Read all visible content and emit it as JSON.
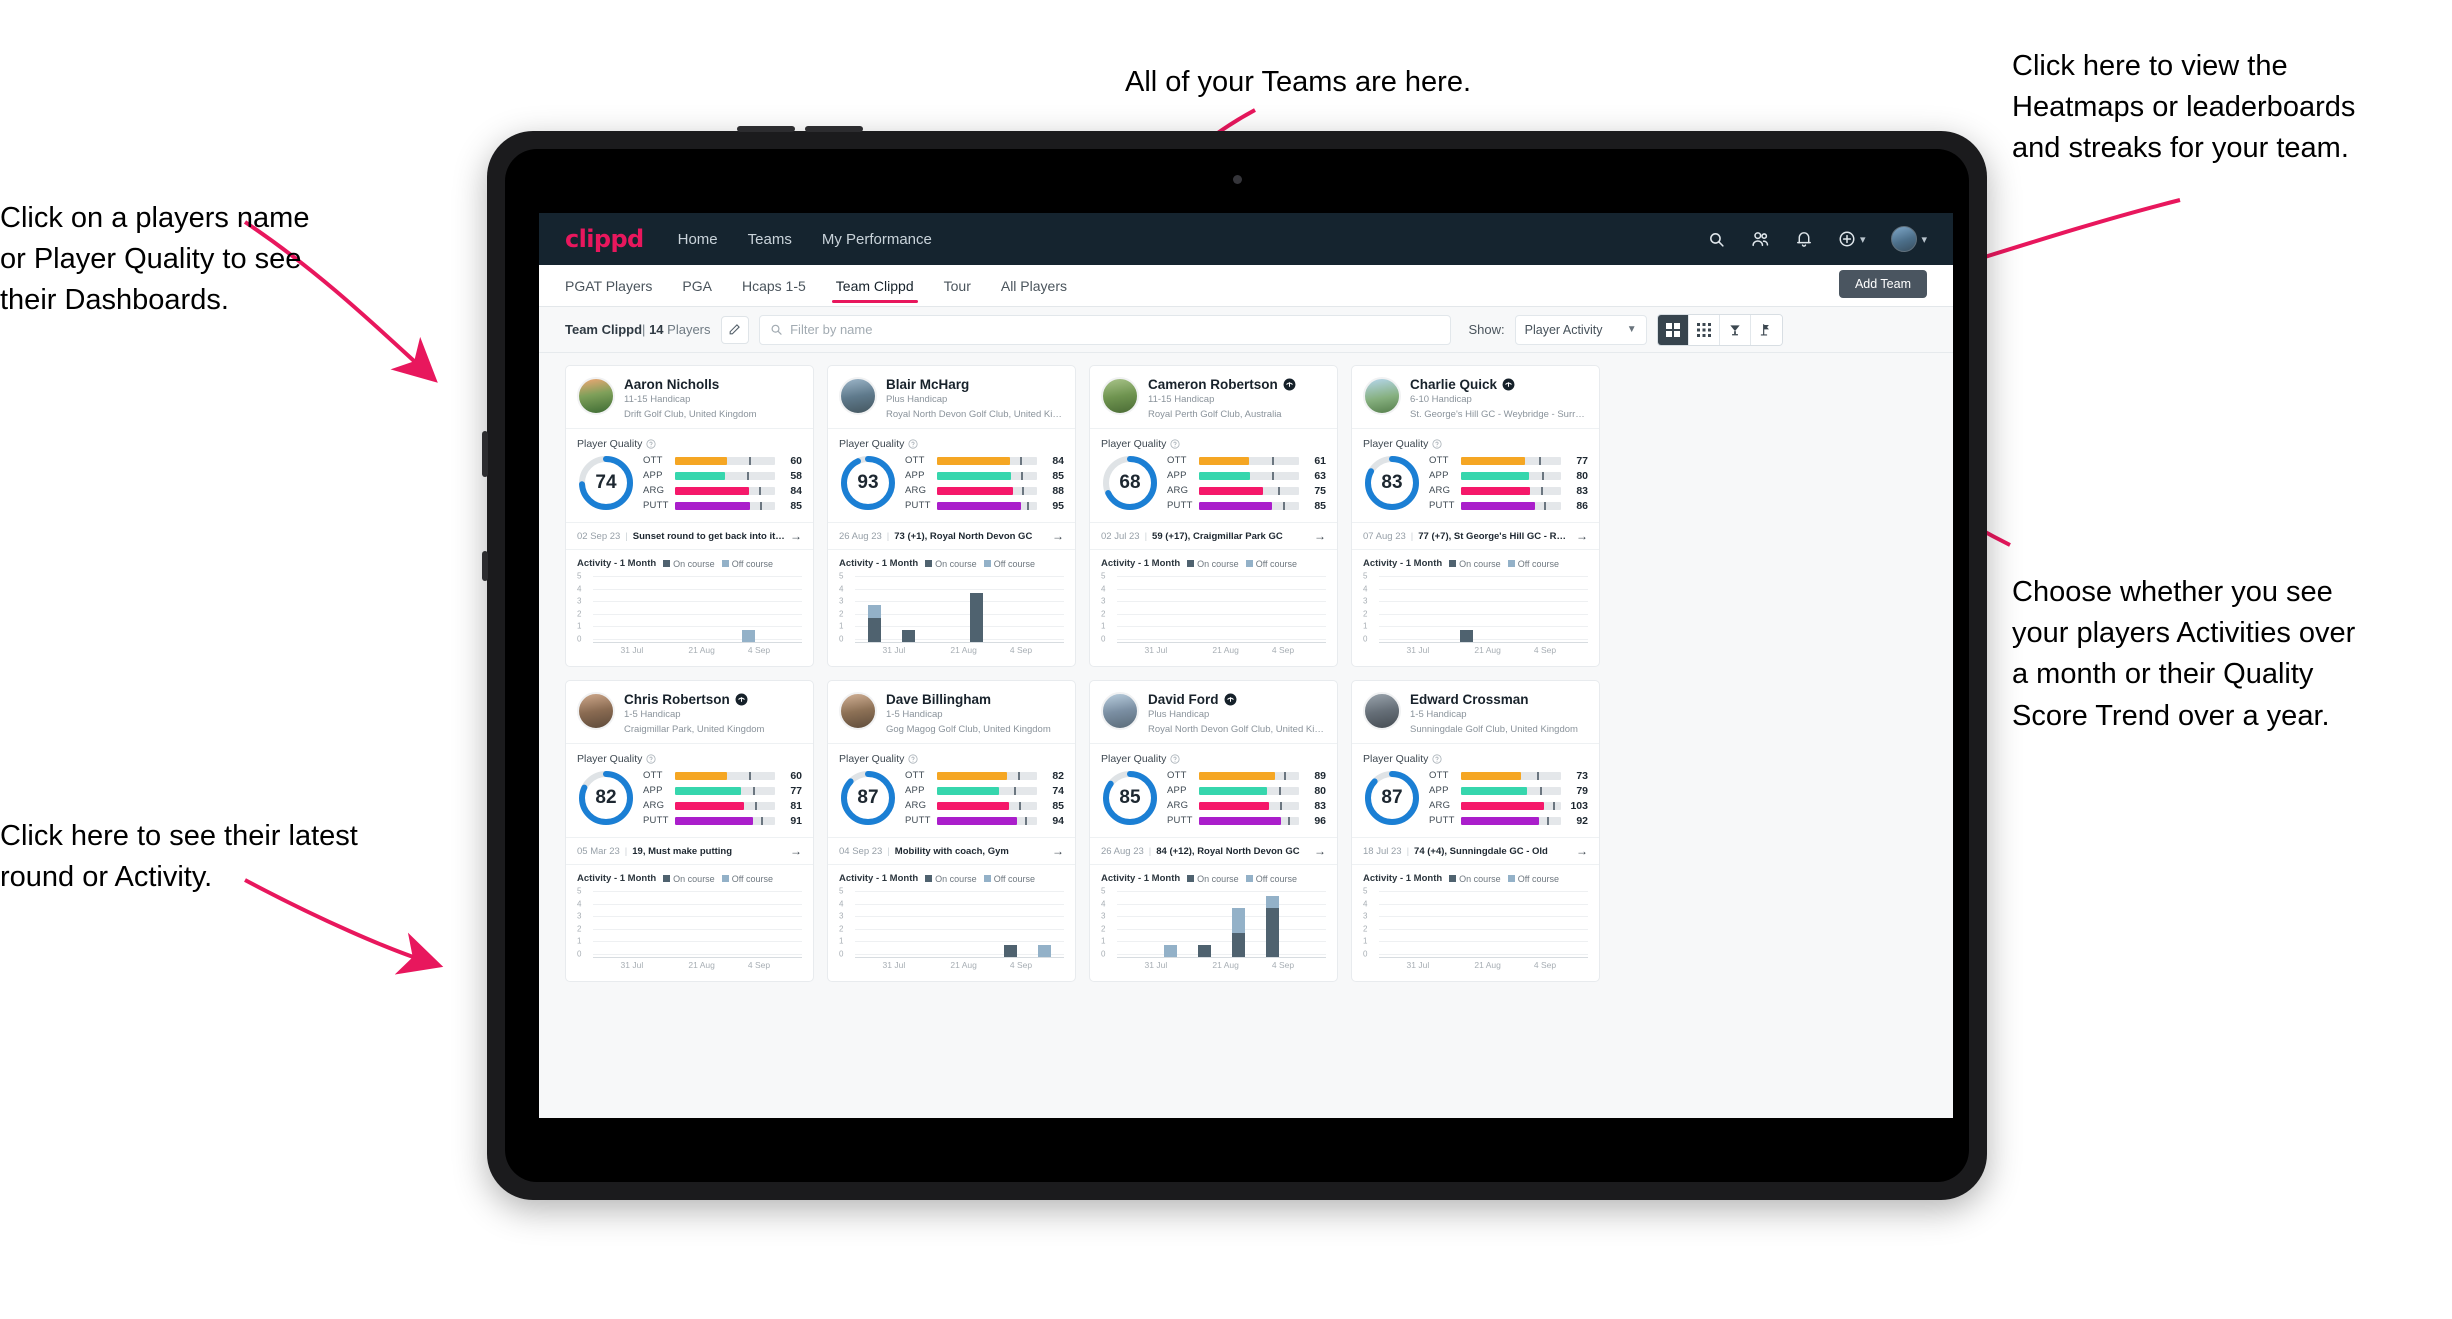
{
  "annotations": [
    {
      "id": "players-name",
      "text": "Click on a players name\nor Player Quality to see\ntheir Dashboards."
    },
    {
      "id": "teams",
      "text": "All of your Teams are here."
    },
    {
      "id": "heatmaps",
      "text": "Click here to view the\nHeatmaps or leaderboards\nand streaks for your team."
    },
    {
      "id": "activity-mode",
      "text": "Choose whether you see\nyour players Activities over\na month or their Quality\nScore Trend over a year."
    },
    {
      "id": "latest-round",
      "text": "Click here to see their latest\nround or Activity."
    }
  ],
  "app": {
    "logo": "clippd",
    "nav": [
      {
        "label": "Home",
        "active": false
      },
      {
        "label": "Teams",
        "active": false
      },
      {
        "label": "My Performance",
        "active": false
      }
    ],
    "header_icons": [
      "search-icon",
      "people-icon",
      "bell-icon",
      "plus-circle-icon",
      "avatar"
    ],
    "tabs": [
      {
        "label": "PGAT Players",
        "active": false
      },
      {
        "label": "PGA",
        "active": false
      },
      {
        "label": "Hcaps 1-5",
        "active": false
      },
      {
        "label": "Team Clippd",
        "active": true
      },
      {
        "label": "Tour",
        "active": false
      },
      {
        "label": "All Players",
        "active": false
      }
    ],
    "add_team_label": "Add Team"
  },
  "toolbar": {
    "team_name": "Team Clippd",
    "separator": "|",
    "player_count": "14",
    "players_word": "Players",
    "edit_icon": "pencil-icon",
    "search_placeholder": "Filter by name",
    "search_value": "",
    "show_label": "Show:",
    "show_value": "Player Activity",
    "show_options": [
      "Player Activity",
      "Quality Score Trend"
    ],
    "views": [
      {
        "name": "large-grid-view",
        "active": true
      },
      {
        "name": "compact-grid-view",
        "active": false
      },
      {
        "name": "leaderboard-view",
        "active": false
      },
      {
        "name": "course-view",
        "active": false
      }
    ]
  },
  "card_labels": {
    "player_quality": "Player Quality",
    "activity_title": "Activity - 1 Month",
    "legend_on": "On course",
    "legend_off": "Off course",
    "metric_names": [
      "OTT",
      "APP",
      "ARG",
      "PUTT"
    ]
  },
  "colors": {
    "brand_pink": "#e8175d",
    "header_navy": "#15242f",
    "ring_blue": "#1b7fd4",
    "ott": "#f5a623",
    "app": "#36d6ad",
    "arg": "#f5186a",
    "putt": "#aa1ecb",
    "on_course": "#4f626f",
    "off_course": "#93b1c8"
  },
  "chart_data": {
    "type": "bar",
    "title": "Activity - 1 Month",
    "ylabel": "",
    "xlabel": "",
    "ylim": [
      0,
      5
    ],
    "yticks": [
      "0",
      "1",
      "2",
      "3",
      "4",
      "5"
    ],
    "xticks": [
      "31 Jul",
      "21 Aug",
      "4 Sep"
    ],
    "grid": true,
    "legend": [
      "On course",
      "Off course"
    ],
    "legend_position": "top",
    "stacked": true
  },
  "players": [
    {
      "name": "Aaron Nicholls",
      "verified": false,
      "handicap": "11-15 Handicap",
      "club": "Drift Golf Club, United Kingdom",
      "quality": 74,
      "metrics": [
        {
          "label": "OTT",
          "value": 60,
          "fill": 52,
          "tick": 74
        },
        {
          "label": "APP",
          "value": 58,
          "fill": 50,
          "tick": 72
        },
        {
          "label": "ARG",
          "value": 84,
          "fill": 74,
          "tick": 84
        },
        {
          "label": "PUTT",
          "value": 85,
          "fill": 75,
          "tick": 85
        }
      ],
      "round_date": "02 Sep 23",
      "round_text": "Sunset round to get back into it, F...",
      "bars": [
        {
          "on": 0,
          "off": 0
        },
        {
          "on": 0,
          "off": 0
        },
        {
          "on": 0,
          "off": 0
        },
        {
          "on": 0,
          "off": 0
        },
        {
          "on": 0,
          "off": 1
        },
        {
          "on": 0,
          "off": 0
        }
      ]
    },
    {
      "name": "Blair McHarg",
      "verified": false,
      "handicap": "Plus Handicap",
      "club": "Royal North Devon Golf Club, United Kin...",
      "quality": 93,
      "metrics": [
        {
          "label": "OTT",
          "value": 84,
          "fill": 73,
          "tick": 83
        },
        {
          "label": "APP",
          "value": 85,
          "fill": 74,
          "tick": 84
        },
        {
          "label": "ARG",
          "value": 88,
          "fill": 76,
          "tick": 85
        },
        {
          "label": "PUTT",
          "value": 95,
          "fill": 84,
          "tick": 90
        }
      ],
      "round_date": "26 Aug 23",
      "round_text": "73 (+1), Royal North Devon GC",
      "bars": [
        {
          "on": 2,
          "off": 1
        },
        {
          "on": 1,
          "off": 0
        },
        {
          "on": 0,
          "off": 0
        },
        {
          "on": 4,
          "off": 0
        },
        {
          "on": 0,
          "off": 0
        },
        {
          "on": 0,
          "off": 0
        }
      ]
    },
    {
      "name": "Cameron Robertson",
      "verified": true,
      "handicap": "11-15 Handicap",
      "club": "Royal Perth Golf Club, Australia",
      "quality": 68,
      "metrics": [
        {
          "label": "OTT",
          "value": 61,
          "fill": 50,
          "tick": 73
        },
        {
          "label": "APP",
          "value": 63,
          "fill": 51,
          "tick": 73
        },
        {
          "label": "ARG",
          "value": 75,
          "fill": 64,
          "tick": 79
        },
        {
          "label": "PUTT",
          "value": 85,
          "fill": 73,
          "tick": 84
        }
      ],
      "round_date": "02 Jul 23",
      "round_text": "59 (+17), Craigmillar Park GC",
      "bars": [
        {
          "on": 0,
          "off": 0
        },
        {
          "on": 0,
          "off": 0
        },
        {
          "on": 0,
          "off": 0
        },
        {
          "on": 0,
          "off": 0
        },
        {
          "on": 0,
          "off": 0
        },
        {
          "on": 0,
          "off": 0
        }
      ]
    },
    {
      "name": "Charlie Quick",
      "verified": true,
      "handicap": "6-10 Handicap",
      "club": "St. George's Hill GC - Weybridge - Surrey, ...",
      "quality": 83,
      "metrics": [
        {
          "label": "OTT",
          "value": 77,
          "fill": 64,
          "tick": 78
        },
        {
          "label": "APP",
          "value": 80,
          "fill": 68,
          "tick": 81
        },
        {
          "label": "ARG",
          "value": 83,
          "fill": 69,
          "tick": 80
        },
        {
          "label": "PUTT",
          "value": 86,
          "fill": 74,
          "tick": 83
        }
      ],
      "round_date": "07 Aug 23",
      "round_text": "77 (+7), St George's Hill GC - Red...",
      "bars": [
        {
          "on": 0,
          "off": 0
        },
        {
          "on": 0,
          "off": 0
        },
        {
          "on": 1,
          "off": 0
        },
        {
          "on": 0,
          "off": 0
        },
        {
          "on": 0,
          "off": 0
        },
        {
          "on": 0,
          "off": 0
        }
      ]
    }
  ],
  "players_row2": [
    {
      "name": "Chris Robertson",
      "verified": true,
      "handicap": "1-5 Handicap",
      "club": "Craigmillar Park, United Kingdom",
      "quality": 82,
      "metrics": [
        {
          "label": "OTT",
          "value": 60,
          "fill": 52,
          "tick": 74
        },
        {
          "label": "APP",
          "value": 77,
          "fill": 66,
          "tick": 78
        },
        {
          "label": "ARG",
          "value": 81,
          "fill": 69,
          "tick": 80
        },
        {
          "label": "PUTT",
          "value": 91,
          "fill": 78,
          "tick": 86
        }
      ],
      "round_date": "05 Mar 23",
      "round_text": "19, Must make putting",
      "bars": [
        {
          "on": 0,
          "off": 0
        },
        {
          "on": 0,
          "off": 0
        },
        {
          "on": 0,
          "off": 0
        },
        {
          "on": 0,
          "off": 0
        },
        {
          "on": 0,
          "off": 0
        },
        {
          "on": 0,
          "off": 0
        }
      ]
    },
    {
      "name": "Dave Billingham",
      "verified": false,
      "handicap": "1-5 Handicap",
      "club": "Gog Magog Golf Club, United Kingdom",
      "quality": 87,
      "metrics": [
        {
          "label": "OTT",
          "value": 82,
          "fill": 70,
          "tick": 81
        },
        {
          "label": "APP",
          "value": 74,
          "fill": 62,
          "tick": 77
        },
        {
          "label": "ARG",
          "value": 85,
          "fill": 72,
          "tick": 82
        },
        {
          "label": "PUTT",
          "value": 94,
          "fill": 80,
          "tick": 88
        }
      ],
      "round_date": "04 Sep 23",
      "round_text": "Mobility with coach, Gym",
      "bars": [
        {
          "on": 0,
          "off": 0
        },
        {
          "on": 0,
          "off": 0
        },
        {
          "on": 0,
          "off": 0
        },
        {
          "on": 0,
          "off": 0
        },
        {
          "on": 1,
          "off": 0
        },
        {
          "on": 0,
          "off": 1
        }
      ]
    },
    {
      "name": "David Ford",
      "verified": true,
      "handicap": "Plus Handicap",
      "club": "Royal North Devon Golf Club, United Kin...",
      "quality": 85,
      "metrics": [
        {
          "label": "OTT",
          "value": 89,
          "fill": 76,
          "tick": 85
        },
        {
          "label": "APP",
          "value": 80,
          "fill": 68,
          "tick": 80
        },
        {
          "label": "ARG",
          "value": 83,
          "fill": 70,
          "tick": 81
        },
        {
          "label": "PUTT",
          "value": 96,
          "fill": 82,
          "tick": 89
        }
      ],
      "round_date": "26 Aug 23",
      "round_text": "84 (+12), Royal North Devon GC",
      "bars": [
        {
          "on": 0,
          "off": 0
        },
        {
          "on": 0,
          "off": 1
        },
        {
          "on": 1,
          "off": 0
        },
        {
          "on": 2,
          "off": 2
        },
        {
          "on": 4,
          "off": 1
        },
        {
          "on": 0,
          "off": 0
        }
      ]
    },
    {
      "name": "Edward Crossman",
      "verified": false,
      "handicap": "1-5 Handicap",
      "club": "Sunningdale Golf Club, United Kingdom",
      "quality": 87,
      "metrics": [
        {
          "label": "OTT",
          "value": 73,
          "fill": 60,
          "tick": 76
        },
        {
          "label": "APP",
          "value": 79,
          "fill": 66,
          "tick": 79
        },
        {
          "label": "ARG",
          "value": 103,
          "fill": 83,
          "tick": 92
        },
        {
          "label": "PUTT",
          "value": 92,
          "fill": 78,
          "tick": 86
        }
      ],
      "round_date": "18 Jul 23",
      "round_text": "74 (+4), Sunningdale GC - Old",
      "bars": [
        {
          "on": 0,
          "off": 0
        },
        {
          "on": 0,
          "off": 0
        },
        {
          "on": 0,
          "off": 0
        },
        {
          "on": 0,
          "off": 0
        },
        {
          "on": 0,
          "off": 0
        },
        {
          "on": 0,
          "off": 0
        }
      ]
    }
  ]
}
